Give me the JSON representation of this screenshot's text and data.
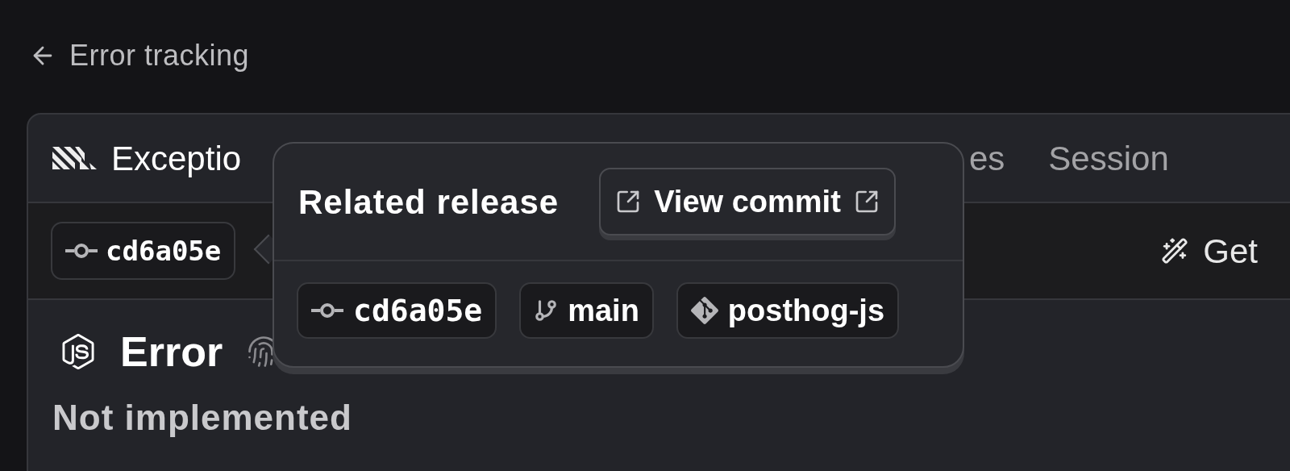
{
  "back_link": {
    "label": "Error tracking"
  },
  "tabs": [
    {
      "label": "Exceptio",
      "selected": true
    },
    {
      "label": "es",
      "selected": false
    },
    {
      "label": "Session",
      "selected": false
    }
  ],
  "toolbar": {
    "release_chip": "cd6a05e",
    "ai_button": "Get"
  },
  "issue": {
    "title": "Error",
    "description": "Not implemented"
  },
  "popover": {
    "title": "Related release",
    "button": "View commit",
    "chips": [
      {
        "kind": "commit",
        "label": "cd6a05e"
      },
      {
        "kind": "branch",
        "label": "main"
      },
      {
        "kind": "repo",
        "label": "posthog-js"
      }
    ]
  }
}
